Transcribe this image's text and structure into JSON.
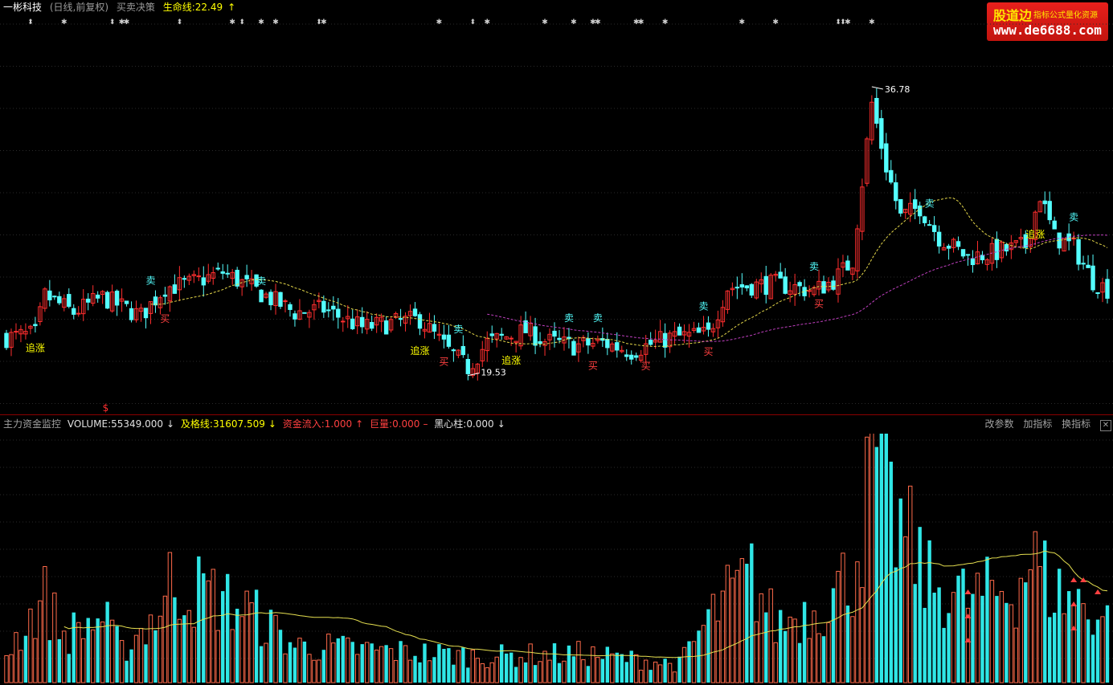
{
  "header": {
    "stock_name": "一彬科技",
    "period": "(日线,前复权)",
    "indicator_name": "买卖决策",
    "lifeline_label": "生命线:22.49",
    "lifeline_arrow": "↑"
  },
  "watermark": {
    "brand": "股道边",
    "tagline": "指标公式量化资源",
    "url": "www.de6688.com"
  },
  "price_chart": {
    "high_label": "36.78",
    "low_label": "19.53",
    "dollar_mark": "$"
  },
  "signals": [
    {
      "text": "追涨",
      "color": "#ffff00",
      "bar": 6,
      "pos": "below"
    },
    {
      "text": "卖",
      "color": "#54ffff",
      "bar": 30,
      "pos": "above"
    },
    {
      "text": "买",
      "color": "#ff4040",
      "bar": 33,
      "pos": "below"
    },
    {
      "text": "卖",
      "color": "#54ffff",
      "bar": 53,
      "pos": "above"
    },
    {
      "text": "追涨",
      "color": "#ffff00",
      "bar": 86,
      "pos": "below"
    },
    {
      "text": "买",
      "color": "#ff4040",
      "bar": 91,
      "pos": "below"
    },
    {
      "text": "卖",
      "color": "#54ffff",
      "bar": 94,
      "pos": "above"
    },
    {
      "text": "追涨",
      "color": "#ffff00",
      "bar": 105,
      "pos": "below"
    },
    {
      "text": "卖",
      "color": "#54ffff",
      "bar": 117,
      "pos": "above"
    },
    {
      "text": "卖",
      "color": "#54ffff",
      "bar": 123,
      "pos": "above"
    },
    {
      "text": "买",
      "color": "#ff4040",
      "bar": 122,
      "pos": "below"
    },
    {
      "text": "买",
      "color": "#ff4040",
      "bar": 133,
      "pos": "below"
    },
    {
      "text": "卖",
      "color": "#54ffff",
      "bar": 145,
      "pos": "above"
    },
    {
      "text": "买",
      "color": "#ff4040",
      "bar": 146,
      "pos": "below"
    },
    {
      "text": "卖",
      "color": "#54ffff",
      "bar": 168,
      "pos": "above"
    },
    {
      "text": "买",
      "color": "#ff4040",
      "bar": 169,
      "pos": "below"
    },
    {
      "text": "卖",
      "color": "#54ffff",
      "bar": 192,
      "pos": "above"
    },
    {
      "text": "追涨",
      "color": "#ffff00",
      "bar": 214,
      "pos": "below"
    },
    {
      "text": "卖",
      "color": "#54ffff",
      "bar": 222,
      "pos": "above"
    }
  ],
  "top_marks": [
    {
      "bar": 5,
      "glyph": "⬍"
    },
    {
      "bar": 12,
      "glyph": "✱"
    },
    {
      "bar": 22,
      "glyph": "⬍"
    },
    {
      "bar": 24,
      "glyph": "✱"
    },
    {
      "bar": 25,
      "glyph": "✱"
    },
    {
      "bar": 36,
      "glyph": "⬍"
    },
    {
      "bar": 47,
      "glyph": "✱"
    },
    {
      "bar": 49,
      "glyph": "⬍"
    },
    {
      "bar": 53,
      "glyph": "✱"
    },
    {
      "bar": 56,
      "glyph": "✱"
    },
    {
      "bar": 65,
      "glyph": "⬍"
    },
    {
      "bar": 66,
      "glyph": "✱"
    },
    {
      "bar": 90,
      "glyph": "✱"
    },
    {
      "bar": 97,
      "glyph": "⬍"
    },
    {
      "bar": 100,
      "glyph": "✱"
    },
    {
      "bar": 112,
      "glyph": "✱"
    },
    {
      "bar": 118,
      "glyph": "✱"
    },
    {
      "bar": 122,
      "glyph": "✱"
    },
    {
      "bar": 123,
      "glyph": "✱"
    },
    {
      "bar": 131,
      "glyph": "✱"
    },
    {
      "bar": 132,
      "glyph": "✱"
    },
    {
      "bar": 137,
      "glyph": "✱"
    },
    {
      "bar": 153,
      "glyph": "✱"
    },
    {
      "bar": 160,
      "glyph": "✱"
    },
    {
      "bar": 173,
      "glyph": "⬍"
    },
    {
      "bar": 174,
      "glyph": "⬍"
    },
    {
      "bar": 175,
      "glyph": "✱"
    },
    {
      "bar": 180,
      "glyph": "✱"
    }
  ],
  "indicator_panel": {
    "name": "主力资金监控",
    "volume": {
      "label": "VOLUME:55349.000",
      "arrow": "↓"
    },
    "pass_line": {
      "label": "及格线:31607.509",
      "arrow": "↓"
    },
    "capital_inflow": {
      "label": "资金流入:1.000",
      "arrow": "↑"
    },
    "huge_volume": {
      "label": "巨量:0.000",
      "arrow": "–"
    },
    "black_heart": {
      "label": "黑心柱:0.000",
      "arrow": "↓"
    },
    "buttons": [
      "改参数",
      "加指标",
      "换指标"
    ],
    "close_glyph": "✕"
  },
  "chart_data": [
    {
      "type": "candlestick",
      "title": "",
      "price_ylim": [
        17.5,
        41.0
      ],
      "annotations": [
        {
          "text": "36.78",
          "value": 36.78
        },
        {
          "text": "19.53",
          "value": 19.53
        }
      ],
      "lifeline_value": 22.49,
      "bars": 230,
      "close_anchor_points": [
        [
          0,
          21.8
        ],
        [
          6,
          22.0
        ],
        [
          8,
          24.3
        ],
        [
          14,
          23.3
        ],
        [
          20,
          24.2
        ],
        [
          28,
          23.1
        ],
        [
          33,
          24.8
        ],
        [
          38,
          25.0
        ],
        [
          45,
          25.7
        ],
        [
          52,
          24.6
        ],
        [
          60,
          23.3
        ],
        [
          66,
          23.5
        ],
        [
          74,
          22.4
        ],
        [
          86,
          22.9
        ],
        [
          92,
          21.0
        ],
        [
          96,
          20.0
        ],
        [
          100,
          21.5
        ],
        [
          108,
          22.2
        ],
        [
          112,
          21.6
        ],
        [
          118,
          21.3
        ],
        [
          124,
          21.5
        ],
        [
          130,
          21.0
        ],
        [
          138,
          21.8
        ],
        [
          146,
          22.0
        ],
        [
          150,
          24.8
        ],
        [
          160,
          25.0
        ],
        [
          168,
          24.6
        ],
        [
          172,
          25.2
        ],
        [
          176,
          26.4
        ],
        [
          180,
          35.8
        ],
        [
          183,
          32.0
        ],
        [
          186,
          29.0
        ],
        [
          190,
          29.6
        ],
        [
          194,
          27.8
        ],
        [
          200,
          26.6
        ],
        [
          206,
          26.9
        ],
        [
          212,
          27.3
        ],
        [
          215,
          30.3
        ],
        [
          218,
          27.8
        ],
        [
          222,
          27.2
        ],
        [
          226,
          25.2
        ],
        [
          229,
          24.7
        ]
      ]
    },
    {
      "type": "bar",
      "title": "主力资金监控",
      "ylim": [
        0,
        95000
      ],
      "current": {
        "VOLUME": 55349.0,
        "及格线": 31607.509,
        "资金流入": 1.0,
        "巨量": 0.0,
        "黑心柱": 0.0
      },
      "volume_anchor_points": [
        [
          0,
          12000
        ],
        [
          8,
          32000
        ],
        [
          12,
          18000
        ],
        [
          20,
          25000
        ],
        [
          24,
          12000
        ],
        [
          33,
          30000
        ],
        [
          34,
          38000
        ],
        [
          42,
          34000
        ],
        [
          50,
          28000
        ],
        [
          60,
          14000
        ],
        [
          80,
          12000
        ],
        [
          100,
          10000
        ],
        [
          120,
          11000
        ],
        [
          140,
          7000
        ],
        [
          146,
          24000
        ],
        [
          150,
          32000
        ],
        [
          155,
          40000
        ],
        [
          160,
          22000
        ],
        [
          170,
          30000
        ],
        [
          176,
          42000
        ],
        [
          180,
          78000
        ],
        [
          182,
          95000
        ],
        [
          184,
          64000
        ],
        [
          188,
          52000
        ],
        [
          192,
          38000
        ],
        [
          200,
          32000
        ],
        [
          210,
          36000
        ],
        [
          213,
          48000
        ],
        [
          218,
          35000
        ],
        [
          224,
          30000
        ],
        [
          229,
          24000
        ]
      ]
    }
  ]
}
